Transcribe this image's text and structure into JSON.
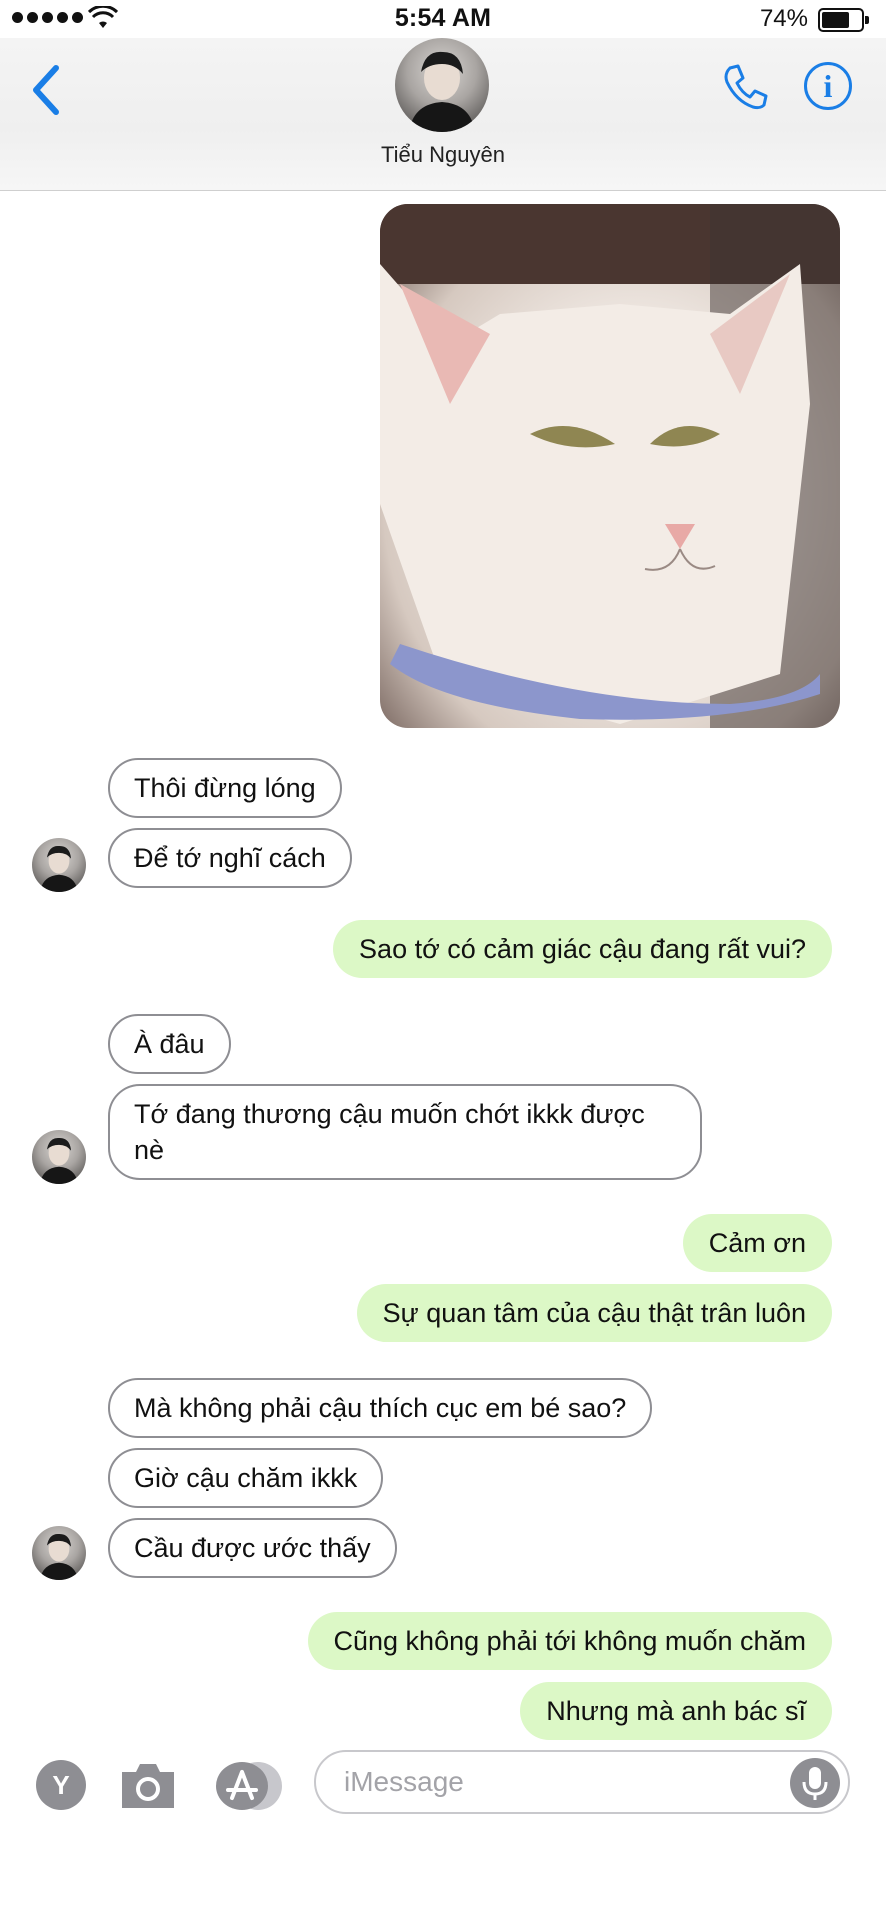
{
  "status_bar": {
    "time": "5:54 AM",
    "battery": "74%"
  },
  "header": {
    "contact_name": "Tiểu Nguyên"
  },
  "messages": [
    {
      "side": "received",
      "text": "Thôi đừng lóng"
    },
    {
      "side": "received",
      "text": "Để tớ nghĩ cách"
    },
    {
      "side": "sent",
      "text": "Sao tớ có cảm giác cậu đang rất vui?"
    },
    {
      "side": "received",
      "text": "À đâu"
    },
    {
      "side": "received",
      "text": "Tớ đang thương cậu muốn chớt ikkk được nè"
    },
    {
      "side": "sent",
      "text": "Cảm ơn"
    },
    {
      "side": "sent",
      "text": "Sự quan tâm của cậu thật trân luôn"
    },
    {
      "side": "received",
      "text": "Mà không phải cậu thích cục em bé sao?"
    },
    {
      "side": "received",
      "text": "Giờ cậu chăm ikkk"
    },
    {
      "side": "received",
      "text": "Cầu được ước thấy"
    },
    {
      "side": "sent",
      "text": "Cũng không phải tới không muốn chăm"
    },
    {
      "side": "sent",
      "text": "Nhưng mà anh bác sĩ"
    }
  ],
  "input_bar": {
    "y_label": "Y",
    "placeholder": "iMessage"
  },
  "colors": {
    "accent": "#1a7ee6",
    "sent_bubble": "#dcf8c6",
    "received_border": "#8e8e93"
  },
  "icons": [
    "back-chevron-icon",
    "phone-icon",
    "info-icon",
    "camera-icon",
    "app-store-icon",
    "microphone-icon",
    "wifi-icon"
  ]
}
